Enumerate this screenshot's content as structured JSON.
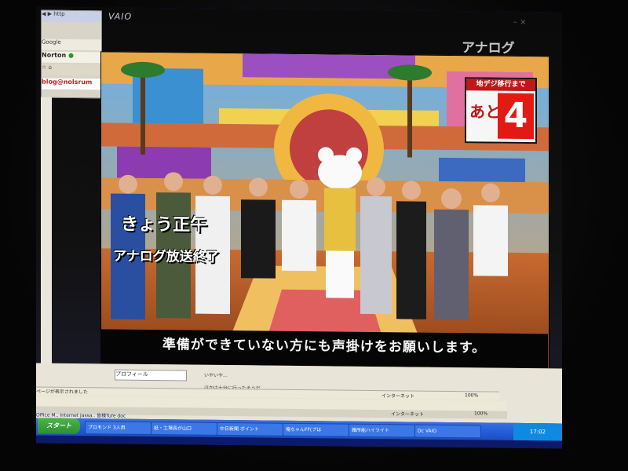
{
  "monitor": {
    "brand": "VAIO"
  },
  "browser": {
    "nav_text": "http",
    "search_text": "Google",
    "norton_label": "Norton",
    "tools_text": "",
    "blog_text": "blog@nolsrum"
  },
  "tv": {
    "corner_label": "アナログ",
    "headline_line1": "きょう正午",
    "headline_line2": "アナログ放送終了",
    "caption": "準備ができていない方にも声掛けをお願いします。",
    "countdown_header": "地デジ移行まで",
    "countdown_prefix": "あと",
    "countdown_number": "4"
  },
  "lower": {
    "tab_label": "プロフィール",
    "text1": "いやいや...",
    "text2": "ほかは十分に行ったそうだ"
  },
  "status": {
    "line1": "ページが表示されました",
    "zone1": "インターネット",
    "zoom1": "100%",
    "zone2": "インターネット",
    "zoom2": "100%",
    "quick_text": "Office M..   Internet Jassa..   皆様Tufe   doc"
  },
  "taskbar": {
    "start_label": "スタート",
    "tasks": [
      "プロモンド 3人用",
      "紙・工場長が山口",
      "中日新聞 ポイント",
      "俺ちゃんFF(プは",
      "雑所能ハイライト",
      "Dc VAIO"
    ],
    "clock": "17:02"
  },
  "colors": {
    "taskbar": "#245edb",
    "start": "#2e8e2e",
    "countdown_red": "#e31a14"
  }
}
